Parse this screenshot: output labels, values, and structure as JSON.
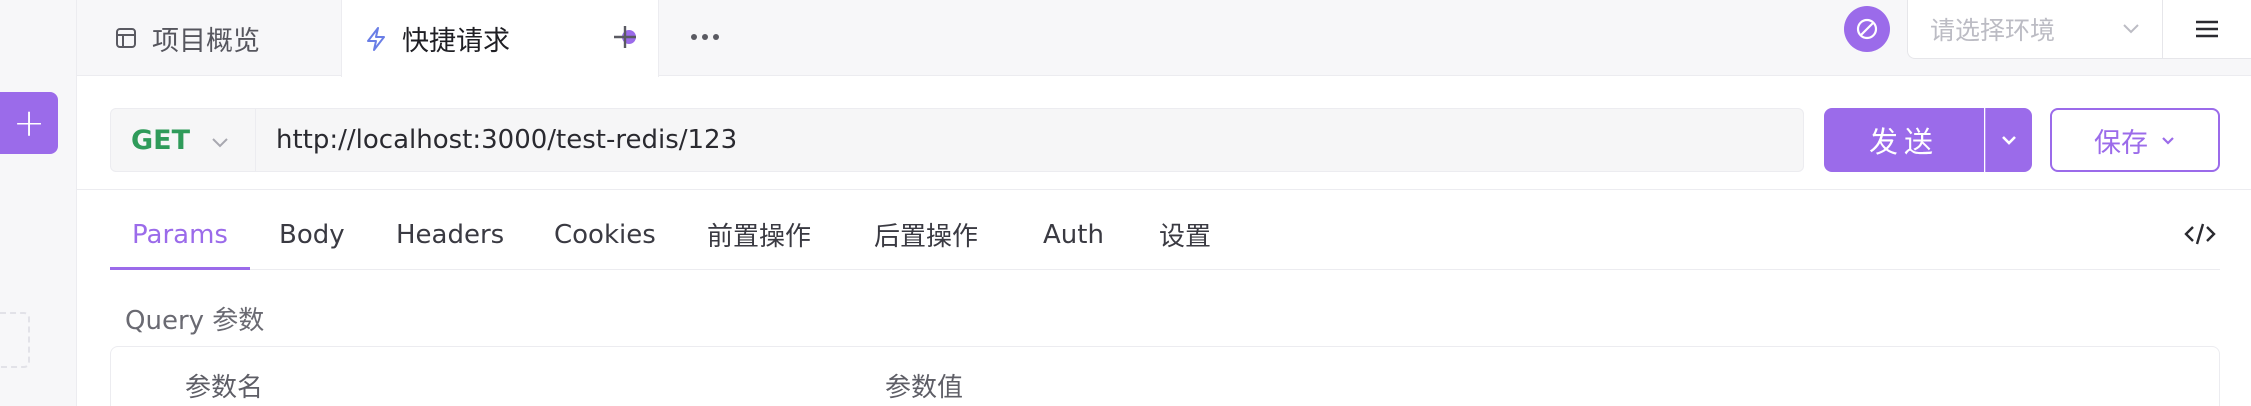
{
  "tabs": {
    "overview_label": "项目概览",
    "quick_request_label": "快捷请求"
  },
  "environment": {
    "placeholder": "请选择环境"
  },
  "request": {
    "method": "GET",
    "url": "http://localhost:3000/test-redis/123",
    "send_label": "发送",
    "save_label": "保存"
  },
  "request_tabs": [
    "Params",
    "Body",
    "Headers",
    "Cookies",
    "前置操作",
    "后置操作",
    "Auth",
    "设置"
  ],
  "query": {
    "title": "Query 参数",
    "col_name": "参数名",
    "col_value": "参数值"
  },
  "colors": {
    "accent": "#9b6bea",
    "method_get": "#2f9b5a"
  },
  "icons": [
    "plus-icon",
    "overview-icon",
    "lightning-icon",
    "more-icon",
    "sync-icon",
    "chevron-down-icon",
    "menu-icon",
    "code-icon"
  ]
}
